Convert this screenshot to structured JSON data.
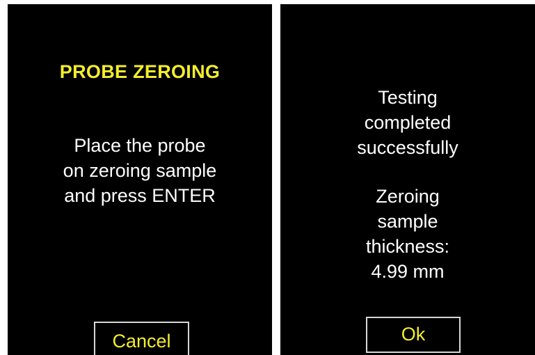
{
  "probe_zeroing_screen": {
    "title": "PROBE ZEROING",
    "instructions": [
      "Place the probe",
      "on zeroing sample",
      "and press ENTER"
    ],
    "cancel_label": "Cancel"
  },
  "result_screen": {
    "status_lines": [
      "Testing",
      "completed",
      "successfully"
    ],
    "thickness_lines": [
      "Zeroing",
      "sample",
      "thickness:",
      "4.99 mm"
    ],
    "ok_label": "Ok"
  },
  "colors": {
    "screen_bg": "#000000",
    "text": "#ffffff",
    "accent_yellow": "#f4ee2a",
    "button_border": "#d8d8d8"
  }
}
